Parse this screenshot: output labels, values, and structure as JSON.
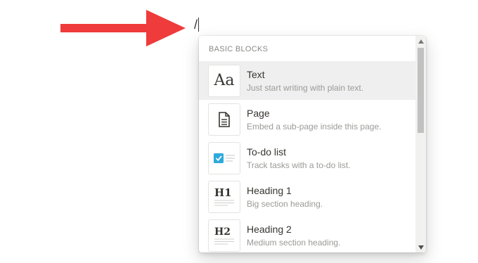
{
  "editor": {
    "typed_text": "/"
  },
  "annotation": {
    "arrow_color": "#ef3b3b",
    "arrow_icon": "pointer-arrow"
  },
  "menu": {
    "section_header": "BASIC BLOCKS",
    "items": [
      {
        "title": "Text",
        "description": "Just start writing with plain text.",
        "icon": "text-aa-icon",
        "glyph": "Aa",
        "selected": true
      },
      {
        "title": "Page",
        "description": "Embed a sub-page inside this page.",
        "icon": "page-document-icon"
      },
      {
        "title": "To-do list",
        "description": "Track tasks with a to-do list.",
        "icon": "todo-checkbox-icon"
      },
      {
        "title": "Heading 1",
        "description": "Big section heading.",
        "icon": "heading1-icon",
        "glyph": "H1"
      },
      {
        "title": "Heading 2",
        "description": "Medium section heading.",
        "icon": "heading2-icon",
        "glyph": "H2"
      }
    ],
    "selected_bg": "#efefef",
    "checkbox_color": "#2eaadc"
  }
}
